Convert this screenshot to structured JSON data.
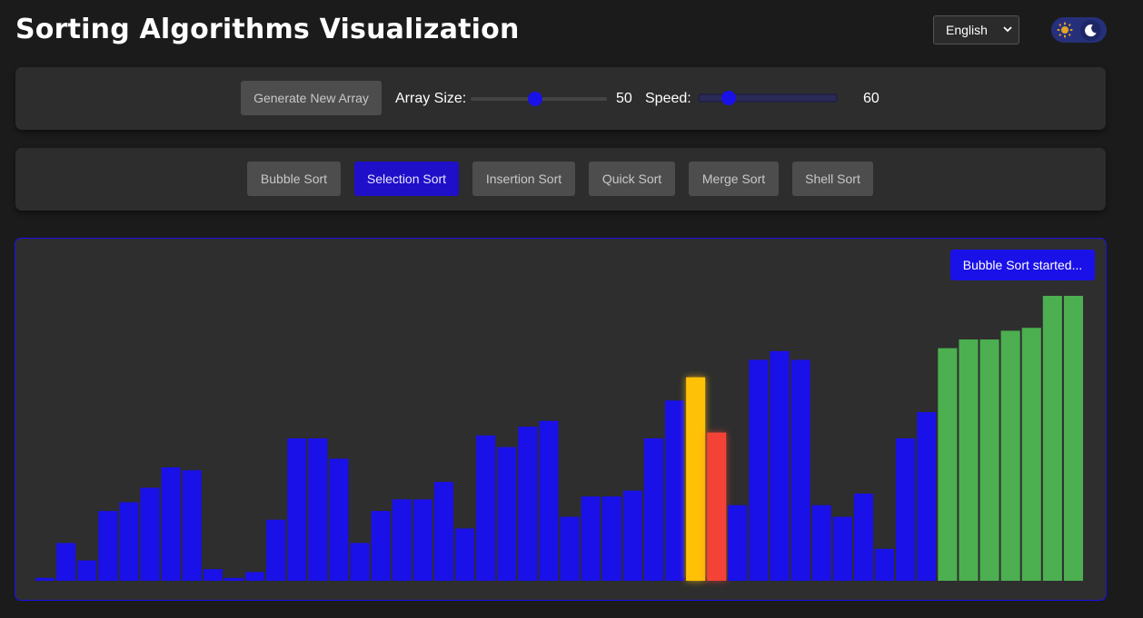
{
  "app": {
    "title": "Sorting Algorithms Visualization"
  },
  "language": {
    "selected": "English"
  },
  "theme": {
    "mode": "dark",
    "sun_icon": "sun-icon",
    "moon_icon": "moon-icon"
  },
  "controls": {
    "generate_label": "Generate New Array",
    "array_size_label": "Array Size:",
    "array_size_value": "50",
    "array_size_fraction": 0.47,
    "speed_label": "Speed:",
    "speed_value": "60",
    "speed_fraction": 0.18
  },
  "algorithms": [
    {
      "label": "Bubble Sort",
      "active": false
    },
    {
      "label": "Selection Sort",
      "active": true
    },
    {
      "label": "Insertion Sort",
      "active": false
    },
    {
      "label": "Quick Sort",
      "active": false
    },
    {
      "label": "Merge Sort",
      "active": false
    },
    {
      "label": "Shell Sort",
      "active": false
    }
  ],
  "status": {
    "message": "Bubble Sort started..."
  },
  "colors": {
    "accent": "#1a10e8",
    "bar_default": "#1a10e8",
    "bar_comparing": "#ffc107",
    "bar_swapping": "#f44336",
    "bar_sorted": "#4caf50"
  },
  "chart_data": {
    "type": "bar",
    "values": [
      1,
      13,
      7,
      24,
      27,
      32,
      39,
      38,
      4,
      1,
      3,
      21,
      49,
      49,
      42,
      13,
      24,
      28,
      28,
      34,
      18,
      50,
      46,
      53,
      55,
      22,
      29,
      29,
      31,
      49,
      62,
      70,
      51,
      26,
      76,
      79,
      76,
      26,
      22,
      30,
      11,
      49,
      58,
      80,
      83,
      83,
      86,
      87,
      98,
      98
    ],
    "states": [
      "default",
      "default",
      "default",
      "default",
      "default",
      "default",
      "default",
      "default",
      "default",
      "default",
      "default",
      "default",
      "default",
      "default",
      "default",
      "default",
      "default",
      "default",
      "default",
      "default",
      "default",
      "default",
      "default",
      "default",
      "default",
      "default",
      "default",
      "default",
      "default",
      "default",
      "default",
      "comparing",
      "swapping",
      "default",
      "default",
      "default",
      "default",
      "default",
      "default",
      "default",
      "default",
      "default",
      "default",
      "sorted",
      "sorted",
      "sorted",
      "sorted",
      "sorted",
      "sorted",
      "sorted"
    ]
  }
}
